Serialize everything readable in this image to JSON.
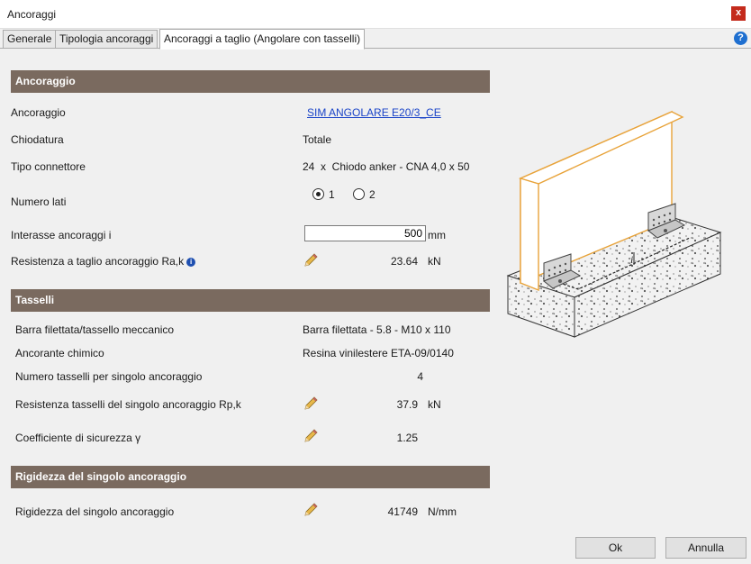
{
  "window": {
    "title": "Ancoraggi",
    "close_label": "x"
  },
  "tabs": [
    {
      "label": "Generale"
    },
    {
      "label": "Tipologia ancoraggi"
    },
    {
      "label": "Ancoraggi a taglio (Angolare con tasselli)"
    }
  ],
  "help_label": "?",
  "sections": {
    "ancoraggio": {
      "title": "Ancoraggio"
    },
    "tasselli": {
      "title": "Tasselli"
    },
    "rigidezza": {
      "title": "Rigidezza del singolo ancoraggio"
    }
  },
  "ancoraggio": {
    "ancoraggio_label": "Ancoraggio",
    "ancoraggio_value": "SIM ANGOLARE E20/3_CE",
    "chiodatura_label": "Chiodatura",
    "chiodatura_value": "Totale",
    "tipo_connettore_label": "Tipo connettore",
    "tipo_connettore_value": "24  x  Chiodo anker - CNA 4,0 x 50",
    "numero_lati_label": "Numero lati",
    "numero_lati_options": [
      "1",
      "2"
    ],
    "interasse_label": "Interasse ancoraggi i",
    "interasse_value": "500",
    "interasse_unit": "mm",
    "resistenza_label": "Resistenza a taglio ancoraggio Ra,k",
    "resistenza_value": "23.64",
    "resistenza_unit": "kN"
  },
  "tasselli": {
    "barra_label": "Barra filettata/tassello meccanico",
    "barra_value": "Barra filettata - 5.8 - M10 x 110",
    "ancorante_label": "Ancorante chimico",
    "ancorante_value": "Resina vinilestere ETA-09/0140",
    "numero_label": "Numero tasselli per singolo ancoraggio",
    "numero_value": "4",
    "resistenza_label": "Resistenza tasselli del singolo ancoraggio Rp,k",
    "resistenza_value": "37.9",
    "resistenza_unit": "kN",
    "coeff_label": "Coefficiente di sicurezza γ",
    "coeff_value": "1.25"
  },
  "rigidezza": {
    "label": "Rigidezza del singolo ancoraggio",
    "value": "41749",
    "unit": "N/mm"
  },
  "illustration": {
    "dimension_label": "i"
  },
  "buttons": {
    "ok": "Ok",
    "cancel": "Annulla"
  }
}
